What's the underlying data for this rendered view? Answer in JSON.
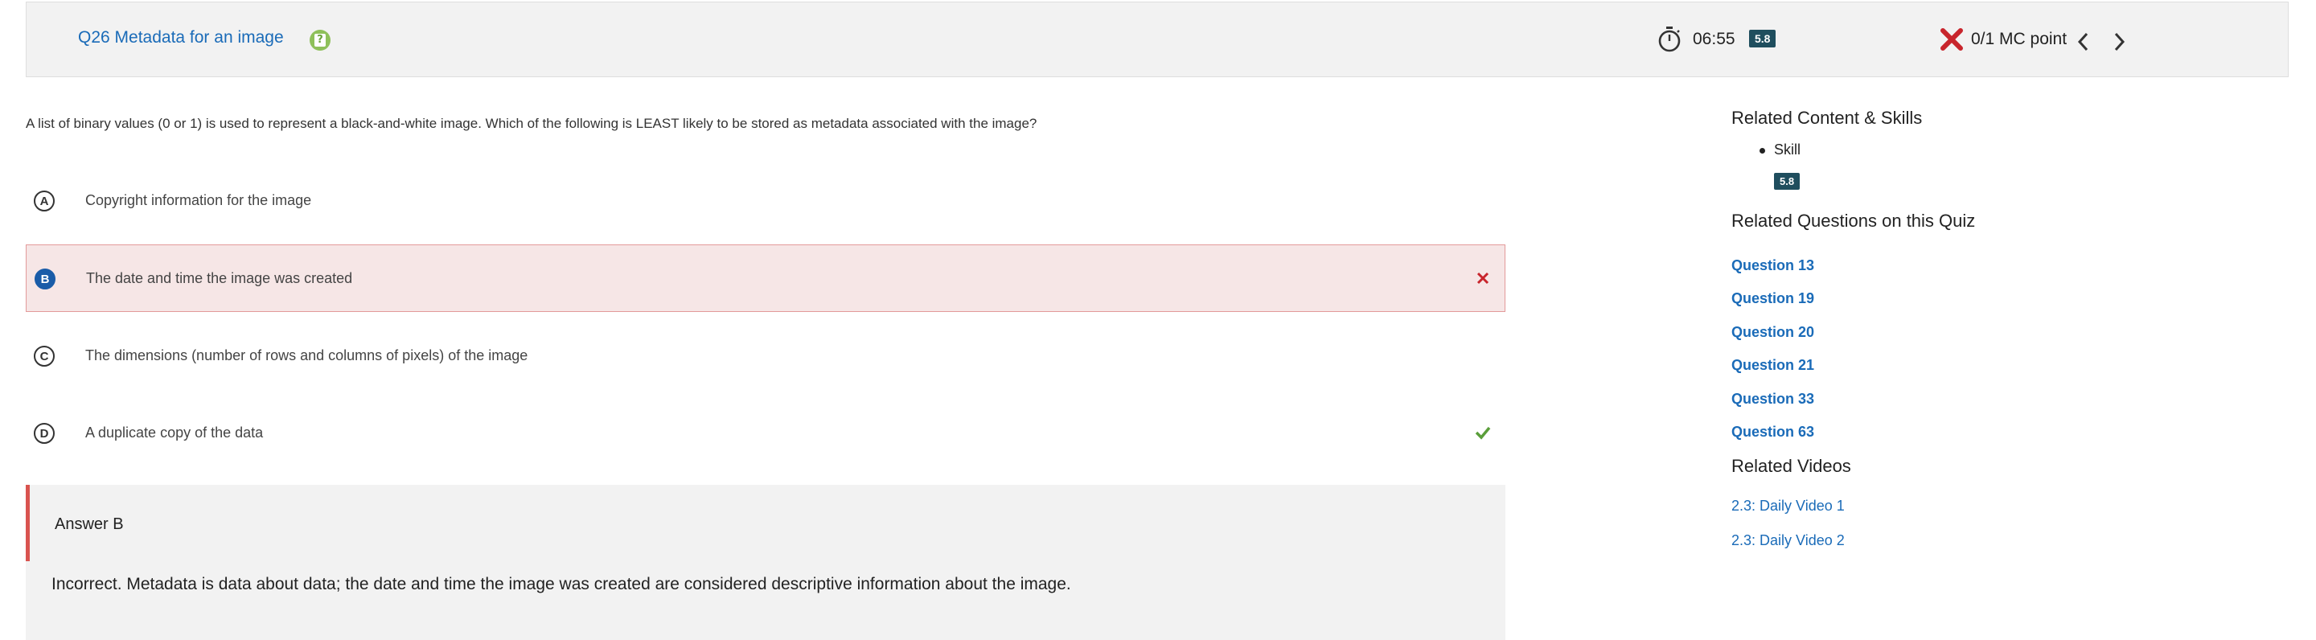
{
  "header": {
    "question_title": "Q26 Metadata for an image",
    "timer": "06:55",
    "skill_badge": "5.8",
    "points": "0/1 MC point"
  },
  "question": {
    "text": "A list of binary values (0 or 1) is used to represent a black-and-white image. Which of the following is LEAST likely to be stored as metadata associated with the image?",
    "options": [
      {
        "letter": "A",
        "text": "Copyright information for the image"
      },
      {
        "letter": "B",
        "text": "The date and time the image was created"
      },
      {
        "letter": "C",
        "text": "The dimensions (number of rows and columns of pixels) of the image"
      },
      {
        "letter": "D",
        "text": "A duplicate copy of the data"
      }
    ]
  },
  "answer": {
    "label": "Answer B",
    "explanation": "Incorrect. Metadata is data about data; the date and time the image was created are considered descriptive information about the image."
  },
  "sidebar": {
    "content_heading": "Related Content & Skills",
    "skill_label": "Skill",
    "skill_badge": "5.8",
    "questions_heading": "Related Questions on this Quiz",
    "questions": [
      "Question 13",
      "Question 19",
      "Question 20",
      "Question 21",
      "Question 33",
      "Question 63"
    ],
    "videos_heading": "Related Videos",
    "videos": [
      "2.3: Daily Video 1",
      "2.3: Daily Video 2"
    ]
  },
  "colors": {
    "link": "#1a6bb8",
    "badge": "#1f4e5e",
    "incorrect": "#c8252c",
    "correct": "#5a9e3a",
    "selected_bg": "#f6e6e6"
  },
  "icons": [
    "help-icon",
    "timer-icon",
    "x-icon",
    "chevron-left-icon",
    "chevron-right-icon",
    "close-icon",
    "check-icon"
  ]
}
